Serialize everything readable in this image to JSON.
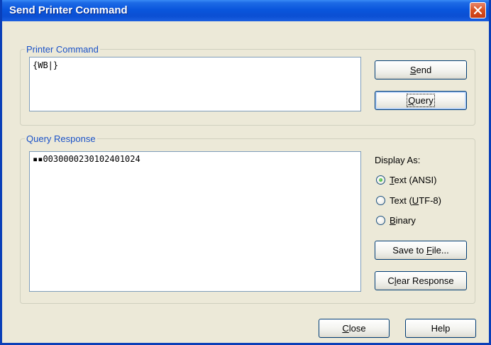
{
  "window": {
    "title": "Send Printer Command",
    "title_color": "#0a56dc"
  },
  "printer_command": {
    "group_label": "Printer Command",
    "value": "{WB|}",
    "send_label": "Send",
    "send_mnemonic": "S",
    "query_label": "Query",
    "query_mnemonic": "Q"
  },
  "query_response": {
    "group_label": "Query Response",
    "value": "▪▪0030000230102401024",
    "display_as_label": "Display As:",
    "options": [
      {
        "label": "Text (ANSI)",
        "mnemonic": "T",
        "selected": true
      },
      {
        "label": "Text (UTF-8)",
        "mnemonic": "U",
        "selected": false
      },
      {
        "label": "Binary",
        "mnemonic": "B",
        "selected": false
      }
    ],
    "save_label": "Save to File...",
    "clear_label": "Clear Response"
  },
  "footer": {
    "close_label": "Close",
    "help_label": "Help"
  },
  "icons": {
    "close": "close-icon",
    "radio": "radio-icon"
  },
  "colors": {
    "group_label": "#1a52c8",
    "radio_selected": "#21a121",
    "close_button": "#d9501f"
  }
}
